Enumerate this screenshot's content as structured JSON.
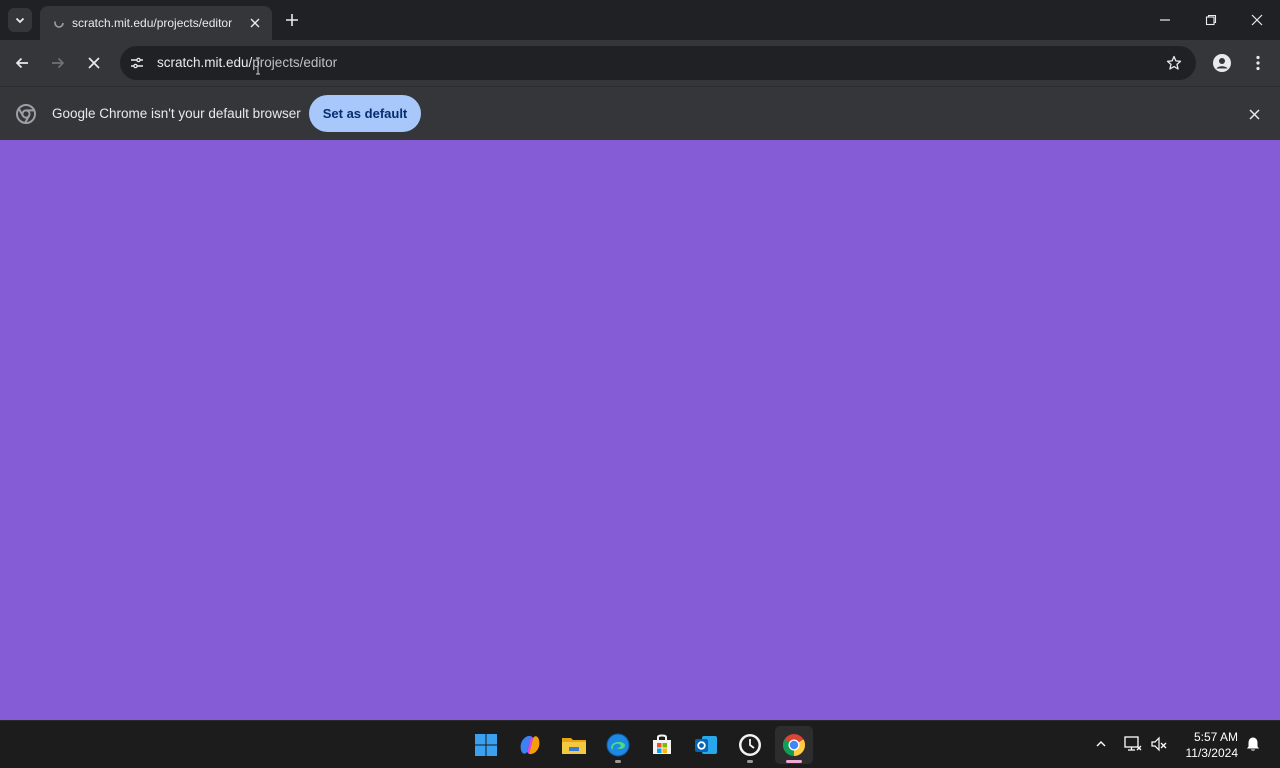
{
  "browser": {
    "tab": {
      "title": "scratch.mit.edu/projects/editor",
      "favicon": "loading-icon"
    },
    "address_bar": {
      "domain": "scratch.mit.edu/",
      "path": "projects/editor"
    },
    "infobar": {
      "message": "Google Chrome isn't your default browser",
      "button_label": "Set as default"
    }
  },
  "page": {
    "background_color": "#855cd6"
  },
  "taskbar": {
    "apps": [
      "start-icon",
      "copilot-icon",
      "file-explorer-icon",
      "edge-icon",
      "store-icon",
      "outlook-icon",
      "clock-app-icon",
      "chrome-icon"
    ],
    "clock": {
      "time": "5:57 AM",
      "date": "11/3/2024"
    }
  }
}
